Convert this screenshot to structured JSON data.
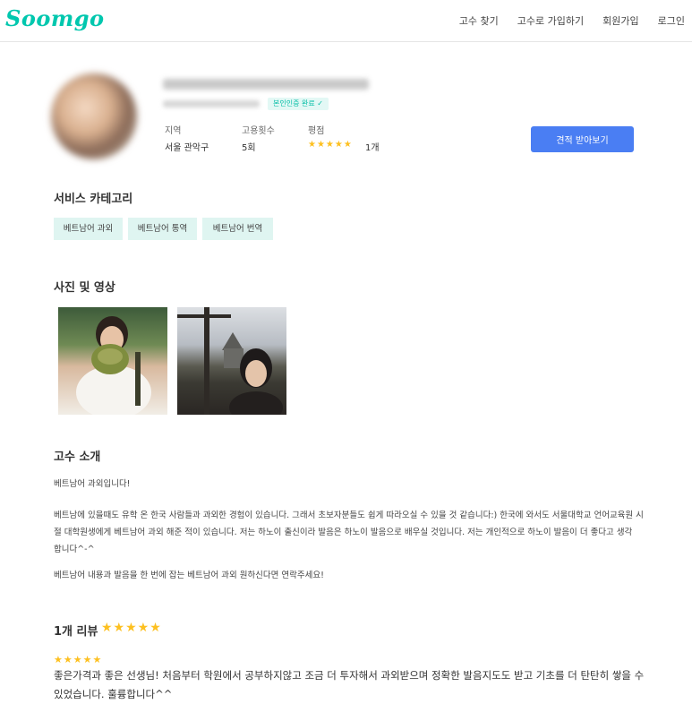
{
  "brand": {
    "logo_text": "Soomgo",
    "color": "#00c7ae"
  },
  "nav": {
    "items": [
      "고수 찾기",
      "고수로 가입하기",
      "회원가입",
      "로그인"
    ]
  },
  "profile": {
    "verified_badge": "본인인증 완료 ✓",
    "labels": {
      "region": "지역",
      "hires": "고용횟수",
      "rating": "평점"
    },
    "values": {
      "region": "서울 관악구",
      "hires": "5회",
      "rating_stars": "★★★★★",
      "review_count": "1개"
    },
    "rating": 5,
    "quote_button": "견적 받아보기",
    "accent": "#4a7ef3"
  },
  "services": {
    "title": "서비스 카테고리",
    "chips": [
      "베트남어 과외",
      "베트남어 통역",
      "베트남어 번역"
    ]
  },
  "media": {
    "title": "사진 및 영상"
  },
  "intro": {
    "title": "고수 소개",
    "p1": "베트남어 과외입니다!",
    "p2_line1": "베트남에 있을때도 유학 온 한국 사람들과 과외한 경험이 있습니다. 그래서 초보자분들도 쉽게 따라오실 수 있을 것 같습니다:) 한국에 와서도 서울대학교 언어교육원 시",
    "p2_line2": "절 대학원생에게 베트남어 과외 해준 적이 있습니다. 저는 하노이 출신이라 발음은 하노이 발음으로 배우실 것입니다. 저는 개인적으로 하노이 발음이 더 좋다고 생각",
    "p2_line3": "합니다^-^",
    "p3": "베트남어 내용과 발음을 한 번에 잡는 베트남어 과외 원하신다면 연락주세요!"
  },
  "reviews": {
    "title": "1개 리뷰",
    "summary_stars": "★★★★★",
    "items": [
      {
        "stars": "★★★★★",
        "text": "좋은가격과 좋은 선생님! 처음부터 학원에서 공부하지않고 조금 더 투자해서 과외받으며 정확한 발음지도도 받고 기초를 더 탄탄히 쌓을 수 있었습니다. 훌륭합니다^^"
      }
    ]
  }
}
